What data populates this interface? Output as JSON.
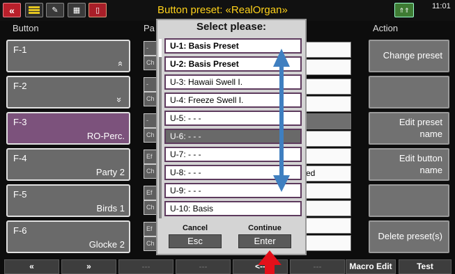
{
  "topbar": {
    "title": "Button preset: «RealOrgan»",
    "clock": "11:01",
    "menu_icon_label": "MENU",
    "edit_icon_label": "EDIT",
    "panel_icon_label": "PANEL",
    "shift_label": "SHIFT",
    "back_icon": "«"
  },
  "headers": {
    "button": "Button",
    "param": "Pa",
    "action": "Action"
  },
  "buttons": [
    {
      "name": "F-1",
      "value": "»"
    },
    {
      "name": "F-2",
      "value": "»"
    },
    {
      "name": "F-3",
      "value": "RO-Perc."
    },
    {
      "name": "F-4",
      "value": "Party 2"
    },
    {
      "name": "F-5",
      "value": "Birds 1"
    },
    {
      "name": "F-6",
      "value": "Glocke 2"
    }
  ],
  "param_cells": [
    "-",
    "Ch",
    "-",
    "Ch",
    "-",
    "Ch",
    "Ef",
    "Ch",
    "Ef",
    "Ch",
    "Ef",
    "Ch"
  ],
  "value_boxes": [
    "",
    "",
    "",
    "",
    "",
    "",
    "",
    "ed",
    "",
    "",
    "",
    ""
  ],
  "actions": [
    {
      "label": "Change preset"
    },
    {
      "label": ""
    },
    {
      "label": "Edit preset name"
    },
    {
      "label": "Edit button name"
    },
    {
      "label": ""
    },
    {
      "label": "Delete preset(s)"
    }
  ],
  "bottom_bar": [
    "«",
    "»",
    "---",
    "---",
    "<--",
    "---",
    "Macro Edit",
    "Test"
  ],
  "dialog": {
    "title": "Select please:",
    "options": [
      {
        "label": "U-1: Basis Preset",
        "bold": true,
        "selected": false
      },
      {
        "label": "U-2: Basis Preset",
        "bold": true,
        "selected": false
      },
      {
        "label": "U-3: Hawaii Swell I.",
        "bold": false,
        "selected": false
      },
      {
        "label": "U-4: Freeze Swell I.",
        "bold": false,
        "selected": false
      },
      {
        "label": "U-5: - - -",
        "bold": false,
        "selected": false
      },
      {
        "label": "U-6: - - -",
        "bold": false,
        "selected": true
      },
      {
        "label": "U-7: - - -",
        "bold": false,
        "selected": false
      },
      {
        "label": "U-8: - - -",
        "bold": false,
        "selected": false
      },
      {
        "label": "U-9: - - -",
        "bold": false,
        "selected": false
      },
      {
        "label": "U-10: Basis",
        "bold": false,
        "selected": false
      }
    ],
    "cancel_label": "Cancel",
    "cancel_key": "Esc",
    "continue_label": "Continue",
    "continue_key": "Enter"
  },
  "colors": {
    "accent_title": "#ffd21a",
    "selected_button": "#7c527c",
    "arrow_blue": "#3f7fc0",
    "pointer_red": "#e3101a"
  }
}
